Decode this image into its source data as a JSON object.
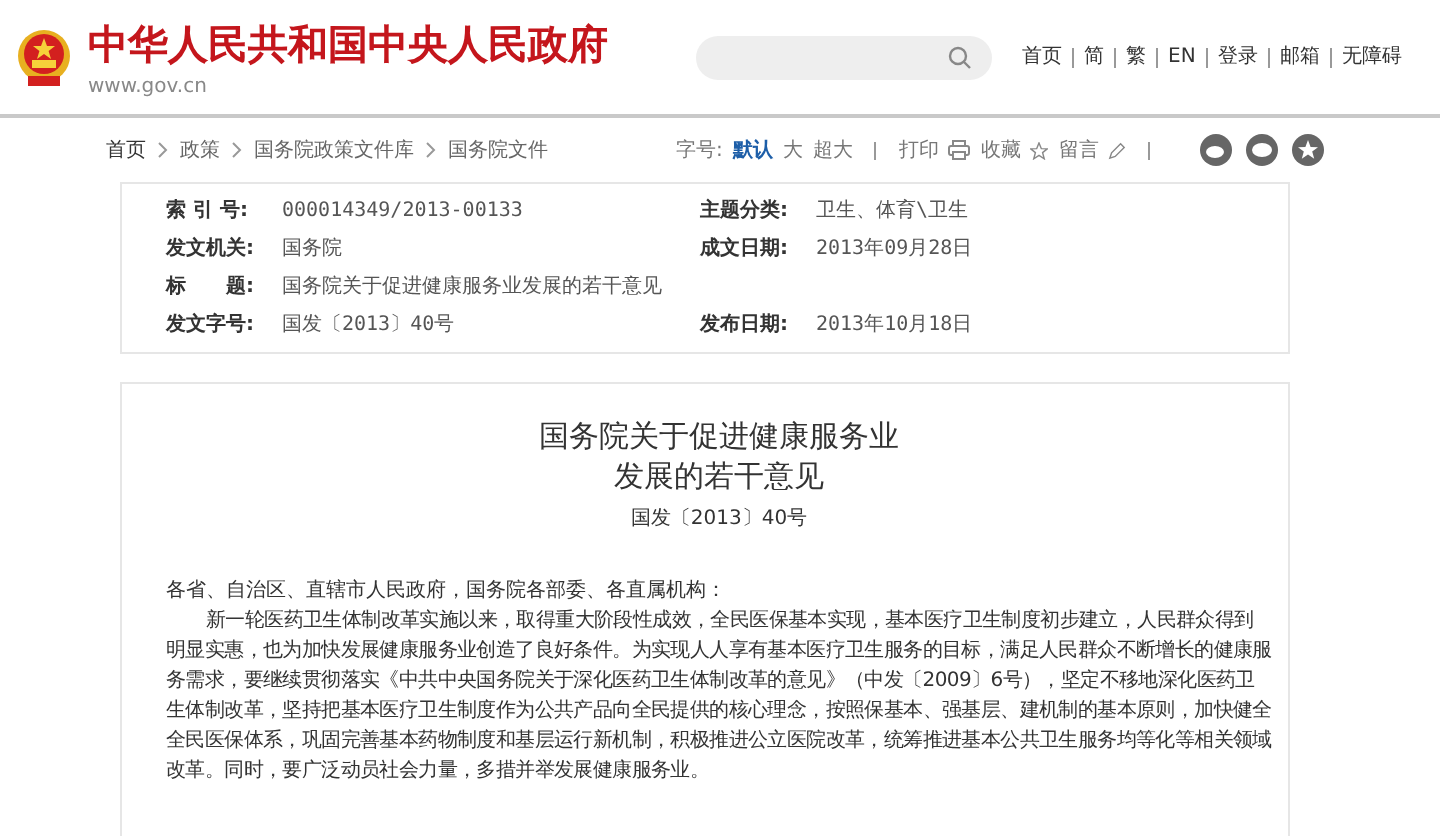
{
  "header": {
    "site_title": "中华人民共和国中央人民政府",
    "site_url": "www.gov.cn",
    "nav_links": [
      "首页",
      "简",
      "繁",
      "EN",
      "登录",
      "邮箱",
      "无障碍"
    ]
  },
  "breadcrumb": [
    "首页",
    "政策",
    "国务院政策文件库",
    "国务院文件"
  ],
  "tools": {
    "font_size_label": "字号:",
    "font_sizes": [
      {
        "label": "默认",
        "selected": true
      },
      {
        "label": "大",
        "selected": false
      },
      {
        "label": "超大",
        "selected": false
      }
    ],
    "print": "打印",
    "favorite": "收藏",
    "comment": "留言"
  },
  "info": {
    "rows": [
      [
        {
          "label": "索 引 号:",
          "value": "000014349/2013-00133"
        },
        {
          "label": "主题分类:",
          "value": "卫生、体育\\卫生"
        }
      ],
      [
        {
          "label": "发文机关:",
          "value": "国务院"
        },
        {
          "label": "成文日期:",
          "value": "2013年09月28日"
        }
      ],
      [
        {
          "label": "标　　题:",
          "value": "国务院关于促进健康服务业发展的若干意见"
        }
      ],
      [
        {
          "label": "发文字号:",
          "value": "国发〔2013〕40号"
        },
        {
          "label": "发布日期:",
          "value": "2013年10月18日"
        }
      ]
    ]
  },
  "article": {
    "title_lines": [
      "国务院关于促进健康服务业",
      "发展的若干意见"
    ],
    "doc_number": "国发〔2013〕40号",
    "salutation": "各省、自治区、直辖市人民政府，国务院各部委、各直属机构：",
    "paragraph": "新一轮医药卫生体制改革实施以来，取得重大阶段性成效，全民医保基本实现，基本医疗卫生制度初步建立，人民群众得到明显实惠，也为加快发展健康服务业创造了良好条件。为实现人人享有基本医疗卫生服务的目标，满足人民群众不断增长的健康服务需求，要继续贯彻落实《中共中央国务院关于深化医药卫生体制改革的意见》（中发〔2009〕6号），坚定不移地深化医药卫生体制改革，坚持把基本医疗卫生制度作为公共产品向全民提供的核心理念，按照保基本、强基层、建机制的基本原则，加快健全全民医保体系，巩固完善基本药物制度和基层运行新机制，积极推进公立医院改革，统筹推进基本公共卫生服务均等化等相关领域改革。同时，要广泛动员社会力量，多措并举发展健康服务业。"
  }
}
